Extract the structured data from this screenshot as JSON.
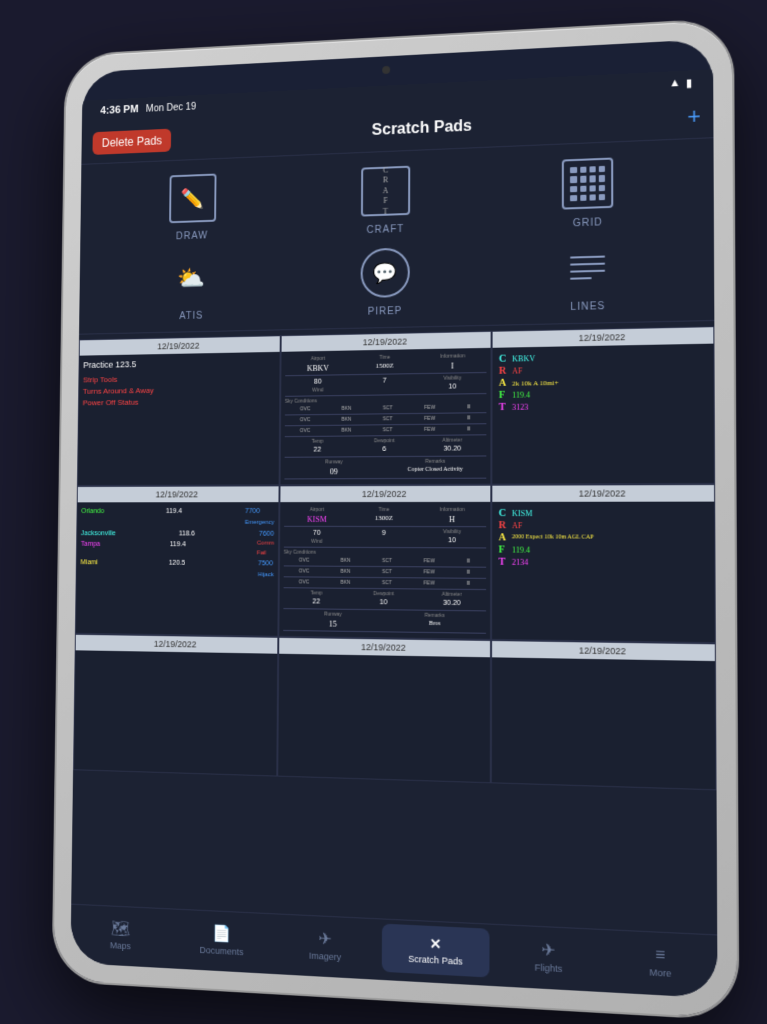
{
  "device": {
    "status_bar": {
      "time": "4:36 PM",
      "date": "Mon Dec 19",
      "wifi": "WiFi",
      "battery": "Battery"
    }
  },
  "nav": {
    "delete_btn": "Delete Pads",
    "title": "Scratch Pads",
    "add_btn": "+"
  },
  "pad_types": [
    {
      "id": "draw",
      "label": "DRAW"
    },
    {
      "id": "craft",
      "label": "CRAFT"
    },
    {
      "id": "grid",
      "label": "GRID"
    },
    {
      "id": "atis",
      "label": "ATIS"
    },
    {
      "id": "pirep",
      "label": "PIREP"
    },
    {
      "id": "lines",
      "label": "LINES"
    }
  ],
  "scratch_pads": [
    {
      "date": "12/19/2022",
      "type": "freehand",
      "content": "practice_checklist"
    },
    {
      "date": "12/19/2022",
      "type": "atis",
      "content": "atis_form_1"
    },
    {
      "date": "12/19/2022",
      "type": "craft",
      "content": "craft_1"
    },
    {
      "date": "12/19/2022",
      "type": "freehand",
      "content": "cities_list"
    },
    {
      "date": "12/19/2022",
      "type": "atis",
      "content": "atis_form_2"
    },
    {
      "date": "12/19/2022",
      "type": "craft",
      "content": "craft_2"
    },
    {
      "date": "12/19/2022",
      "type": "empty",
      "content": ""
    },
    {
      "date": "12/19/2022",
      "type": "empty",
      "content": ""
    },
    {
      "date": "12/19/2022",
      "type": "empty",
      "content": ""
    }
  ],
  "tabs": [
    {
      "id": "maps",
      "label": "Maps",
      "icon": "🗺",
      "active": false
    },
    {
      "id": "documents",
      "label": "Documents",
      "icon": "📄",
      "active": false
    },
    {
      "id": "imagery",
      "label": "Imagery",
      "icon": "🛦",
      "active": false
    },
    {
      "id": "scratch-pads",
      "label": "Scratch Pads",
      "icon": "✕",
      "active": true
    },
    {
      "id": "flights",
      "label": "Flights",
      "icon": "✈",
      "active": false
    },
    {
      "id": "more",
      "label": "More",
      "icon": "≡",
      "active": false
    }
  ]
}
